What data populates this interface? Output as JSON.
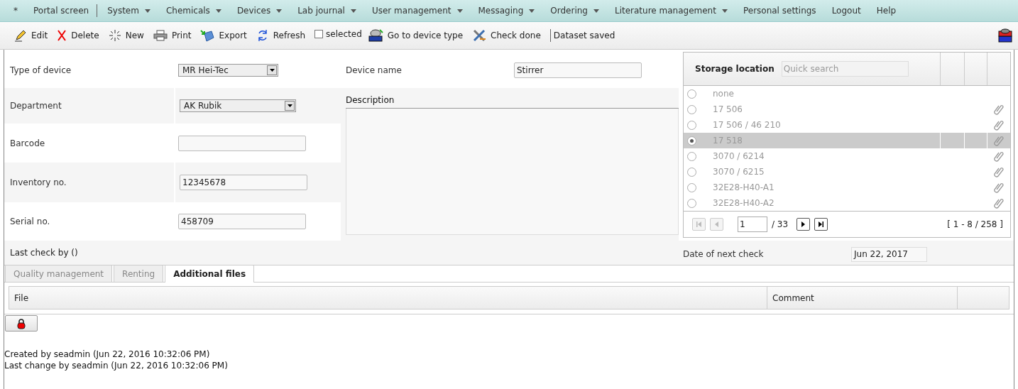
{
  "menu": [
    {
      "label": "*",
      "has_dropdown": false,
      "separator_after": false
    },
    {
      "label": "Portal screen",
      "has_dropdown": false,
      "separator_after": true
    },
    {
      "label": "System",
      "has_dropdown": true,
      "separator_after": false
    },
    {
      "label": "Chemicals",
      "has_dropdown": true,
      "separator_after": false
    },
    {
      "label": "Devices",
      "has_dropdown": true,
      "separator_after": false
    },
    {
      "label": "Lab journal",
      "has_dropdown": true,
      "separator_after": false
    },
    {
      "label": "User management",
      "has_dropdown": true,
      "separator_after": false
    },
    {
      "label": "Messaging",
      "has_dropdown": true,
      "separator_after": false
    },
    {
      "label": "Ordering",
      "has_dropdown": true,
      "separator_after": false
    },
    {
      "label": "Literature management",
      "has_dropdown": true,
      "separator_after": false
    },
    {
      "label": "Personal settings",
      "has_dropdown": false,
      "separator_after": false
    },
    {
      "label": "Logout",
      "has_dropdown": false,
      "separator_after": false
    },
    {
      "label": "Help",
      "has_dropdown": false,
      "separator_after": false
    }
  ],
  "toolbar": [
    {
      "kind": "button",
      "label": "Edit"
    },
    {
      "kind": "button",
      "label": "Delete"
    },
    {
      "kind": "button",
      "label": "New"
    },
    {
      "kind": "button",
      "label": "Print"
    },
    {
      "kind": "button",
      "label": "Export"
    },
    {
      "kind": "button",
      "label": "Refresh"
    },
    {
      "kind": "checkbox",
      "label": "selected",
      "checked": false
    },
    {
      "kind": "button",
      "label": "Go to device type"
    },
    {
      "kind": "button",
      "label": "Check done"
    },
    {
      "kind": "status",
      "label": "Dataset saved"
    }
  ],
  "form": [
    {
      "label": "Type of device",
      "kind": "select",
      "value": "MR Hei-Tec"
    },
    {
      "label": "Department",
      "kind": "select",
      "value": "AK Rubik"
    },
    {
      "label": "Barcode",
      "kind": "input"
    },
    {
      "label": "Inventory no.",
      "kind": "input",
      "value": "12345678"
    },
    {
      "label": "Serial no.",
      "kind": "input",
      "value": "458709"
    }
  ],
  "device_name": {
    "label": "Device name",
    "value": "Stirrer"
  },
  "description": {
    "label": "Description"
  },
  "storage": {
    "title": "Storage location",
    "search_placeholder": "Quick search",
    "rows": [
      {
        "label": "none",
        "selected": false,
        "attachment": false
      },
      {
        "label": "17 506",
        "selected": false,
        "attachment": true
      },
      {
        "label": "17 506 / 46 210",
        "selected": false,
        "attachment": true
      },
      {
        "label": "17 518",
        "selected": true,
        "attachment": true
      },
      {
        "label": "3070 / 6214",
        "selected": false,
        "attachment": true
      },
      {
        "label": "3070 / 6215",
        "selected": false,
        "attachment": true
      },
      {
        "label": "32E28-H40-A1",
        "selected": false,
        "attachment": true
      },
      {
        "label": "32E28-H40-A2",
        "selected": false,
        "attachment": true
      }
    ],
    "pager": {
      "page": "1",
      "total": "/ 33",
      "range": "[ 1 - 8 / 258 ]",
      "back_disabled": true
    }
  },
  "last_check": "Last check by ()",
  "next_check": {
    "label": "Date of next check",
    "value": "Jun 22, 2017"
  },
  "tabs": [
    {
      "label": "Quality management",
      "selected": false
    },
    {
      "label": "Renting",
      "selected": false
    },
    {
      "label": "Additional files",
      "selected": true
    }
  ],
  "files_table": {
    "columns": [
      "File",
      "Comment"
    ]
  },
  "footer": [
    "Created by seadmin (Jun 22, 2016 10:32:06 PM)",
    "Last change by seadmin (Jun 22, 2016 10:32:06 PM)"
  ]
}
